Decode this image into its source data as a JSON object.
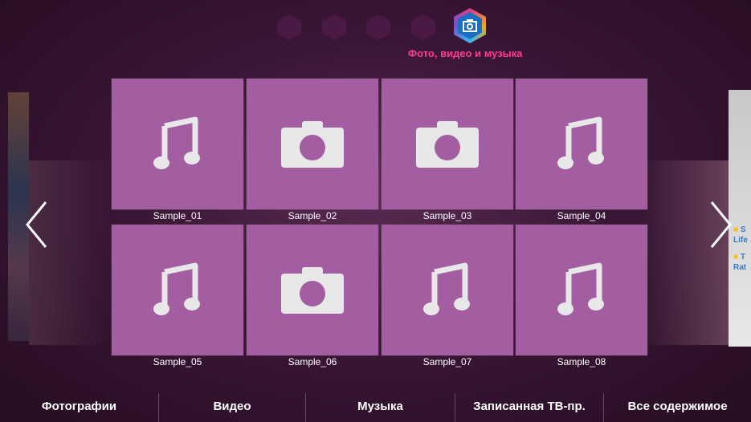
{
  "hub": {
    "icons": [
      {
        "name": "chat-icon",
        "glyph": "🗨",
        "color": "#f4c21d"
      },
      {
        "name": "apps-icon",
        "glyph": "⧉",
        "color": "#6fc83a"
      },
      {
        "name": "tv-icon",
        "glyph": "📺",
        "color": "#3ab7e8"
      },
      {
        "name": "play-icon",
        "glyph": "▷",
        "color": "#a05ce0"
      },
      {
        "name": "camera-icon",
        "glyph": "📷",
        "color": "#ffffff"
      }
    ],
    "active_label": "Фото, видео и музыка"
  },
  "grid": {
    "items": [
      {
        "label": "Sample_01",
        "type": "music"
      },
      {
        "label": "Sample_02",
        "type": "photo"
      },
      {
        "label": "Sample_03",
        "type": "photo"
      },
      {
        "label": "Sample_04",
        "type": "music"
      },
      {
        "label": "Sample_05",
        "type": "music"
      },
      {
        "label": "Sample_06",
        "type": "photo"
      },
      {
        "label": "Sample_07",
        "type": "music"
      },
      {
        "label": "Sample_08",
        "type": "music"
      }
    ]
  },
  "right_preview": {
    "line1": "S",
    "line2": "Life",
    "line3": "T",
    "line4": "Rat"
  },
  "tabs": [
    "Фотографии",
    "Видео",
    "Музыка",
    "Записанная ТВ-пр.",
    "Все содержимое"
  ],
  "colors": {
    "tile_bg": "#a25ea0",
    "accent_pink": "#ff3d8a",
    "icon_fill": "#e8e8e8"
  }
}
